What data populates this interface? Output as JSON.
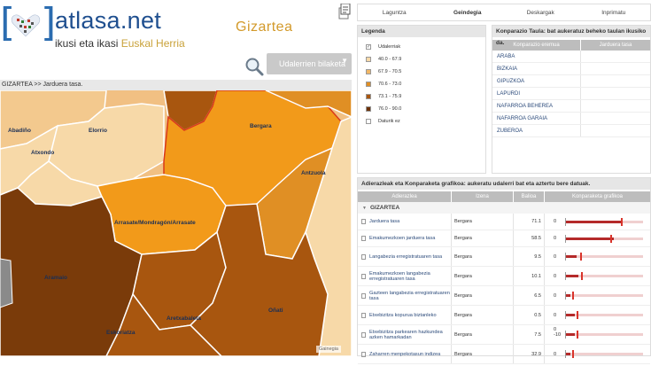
{
  "logo": {
    "name": "atlasa.net",
    "tagline_prefix": "ikusi eta ikasi ",
    "tagline_region": "Euskal Herria"
  },
  "section_logo": "Gizartea",
  "search": {
    "button_label": "Udalerrien bilaketa"
  },
  "breadcrumb": "GIZARTEA >>  Jarduera tasa.",
  "nav": {
    "tabs": [
      "Laguntza",
      "Geindegia",
      "Deskargak",
      "Inprimatu"
    ],
    "active": 1
  },
  "legend": {
    "title": "Legenda",
    "items": [
      {
        "label": "Udalerriak",
        "type": "check",
        "color": ""
      },
      {
        "label": "40.0 - 67.9",
        "type": "swatch",
        "color": "#f7d9a8"
      },
      {
        "label": "67.9 - 70.5",
        "type": "swatch",
        "color": "#f1b766"
      },
      {
        "label": "70.6 - 73.0",
        "type": "swatch",
        "color": "#e08f24"
      },
      {
        "label": "73.1 - 75.9",
        "type": "swatch",
        "color": "#a8560f"
      },
      {
        "label": "76.0 - 90.0",
        "type": "swatch",
        "color": "#6b3208"
      },
      {
        "label": "Daturik ez",
        "type": "check",
        "color": ""
      }
    ]
  },
  "comparison": {
    "title": "Konparazio Taula: bat aukeratuz beheko taulan ikusiko da.",
    "col1": "Konparazio eremua",
    "col2": "Jarduera tasa",
    "rows": [
      "ARABA",
      "BIZKAIA",
      "GIPUZKOA",
      "LAPURDI",
      "NAFARROA BEHEREA",
      "NAFARROA GARAIA",
      "ZUBEROA"
    ]
  },
  "indicators": {
    "title": "Adierazleak eta Konparaketa grafikoa: aukeratu udalerri bat eta aztertu bere datuak.",
    "col_name": "Adierazlea",
    "col_place": "Izena",
    "col_value": "Balioa",
    "col_chart": "Konparaketa grafikoa",
    "group": "GIZARTEA",
    "rows": [
      {
        "name": "Jarduera tasa",
        "place": "Bergara",
        "value": "71.1",
        "lo": "0",
        "lo2": "",
        "fill": 0.74,
        "mark": 0.71
      },
      {
        "name": "Emakumezkoen jarduera tasa",
        "place": "Bergara",
        "value": "58.5",
        "lo": "0",
        "lo2": "",
        "fill": 0.62,
        "mark": 0.58
      },
      {
        "name": "Langabezia erregistratuaren tasa",
        "place": "Bergara",
        "value": "9.5",
        "lo": "0",
        "lo2": "",
        "fill": 0.14,
        "mark": 0.18
      },
      {
        "name": "Emakumezkoen langabezia erregistratuaren tasa",
        "place": "Bergara",
        "value": "10.1",
        "lo": "0",
        "lo2": "",
        "fill": 0.16,
        "mark": 0.2
      },
      {
        "name": "Gazteen langabezia erregistratuaren tasa",
        "place": "Bergara",
        "value": "6.5",
        "lo": "0",
        "lo2": "",
        "fill": 0.06,
        "mark": 0.08
      },
      {
        "name": "Etxebizitza kopurua biztanleko",
        "place": "Bergara",
        "value": "0.5",
        "lo": "0",
        "lo2": "",
        "fill": 0.12,
        "mark": 0.14
      },
      {
        "name": "Etxebizitza parkearen hazkundea azken hamarkadan",
        "place": "Bergara",
        "value": "7.5",
        "lo": "-10",
        "lo2": "0",
        "fill": 0.12,
        "mark": 0.14
      },
      {
        "name": "Zaharren menpekotasun indizea",
        "place": "Bergara",
        "value": "32.9",
        "lo": "0",
        "lo2": "",
        "fill": 0.06,
        "mark": 0.08
      }
    ]
  },
  "map": {
    "labels": [
      "Abadiño",
      "Elorrio",
      "Bergara",
      "Atxondo",
      "Antzuola",
      "Arrasate/Mondragón/Arrasate",
      "Aramaio",
      "Eskoriatza",
      "Aretxabaleta",
      "Oñati"
    ],
    "attribution": "Gainegia"
  }
}
